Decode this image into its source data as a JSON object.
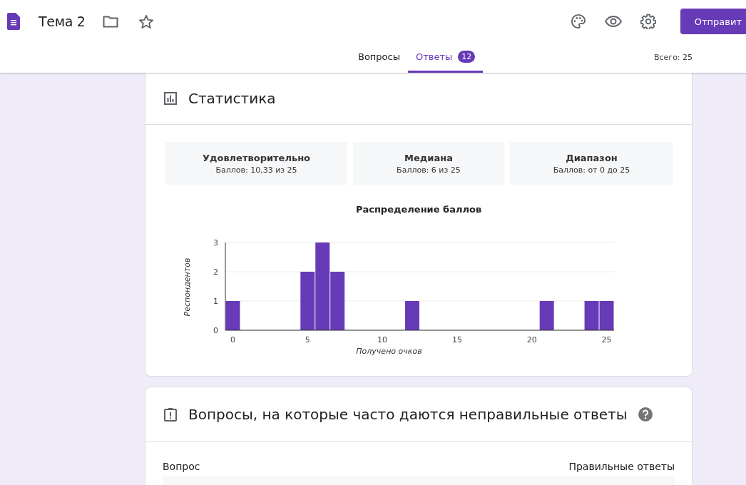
{
  "header": {
    "title": "Тема 2",
    "send_button": "Отправит"
  },
  "tabs": [
    {
      "label": "Вопросы",
      "selected": false
    },
    {
      "label": "Ответы",
      "selected": true,
      "badge": "12"
    }
  ],
  "total": "Всего: 25",
  "statistics": {
    "title": "Статистика",
    "summary": [
      {
        "label": "Удовлетворительно",
        "value": "Баллов: 10,33 из 25"
      },
      {
        "label": "Медиана",
        "value": "Баллов: 6 из 25"
      },
      {
        "label": "Диапазон",
        "value": "Баллов: от 0 до 25"
      }
    ],
    "chart_data": {
      "type": "bar",
      "title": "Распределение баллов",
      "xlabel": "Получено очков",
      "ylabel": "Респондентов",
      "x": [
        0,
        1,
        2,
        3,
        4,
        5,
        6,
        7,
        8,
        9,
        10,
        11,
        12,
        13,
        14,
        15,
        16,
        17,
        18,
        19,
        20,
        21,
        22,
        23,
        24,
        25
      ],
      "values": [
        1,
        0,
        0,
        0,
        0,
        2,
        3,
        2,
        0,
        0,
        0,
        0,
        1,
        0,
        0,
        0,
        0,
        0,
        0,
        0,
        0,
        1,
        0,
        0,
        1,
        1
      ],
      "xlim": [
        -0.5,
        25.5
      ],
      "ylim": [
        0,
        3
      ],
      "xticks": [
        0,
        5,
        10,
        15,
        20,
        25
      ],
      "yticks": [
        0,
        1,
        2,
        3
      ]
    }
  },
  "wrong_answers": {
    "title": "Вопросы, на которые часто даются неправильные ответы",
    "columns": [
      "Вопрос",
      "Правильные ответы"
    ]
  }
}
